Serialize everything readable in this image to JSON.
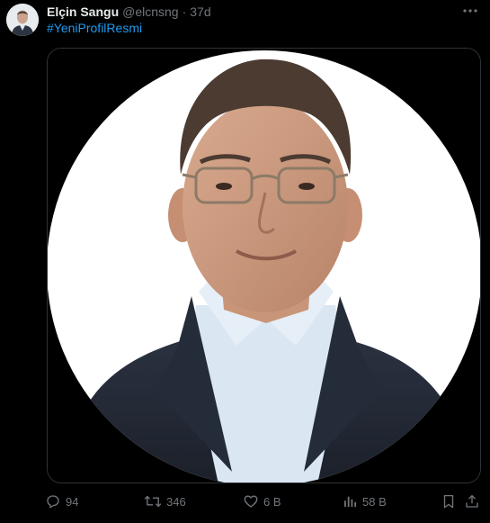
{
  "tweet": {
    "display_name": "Elçin Sangu",
    "handle": "@elcnsng",
    "separator": "·",
    "time": "37d",
    "text": "#YeniProfilResmi"
  },
  "actions": {
    "replies": "94",
    "retweets": "346",
    "likes": "6 B",
    "views": "58 B"
  },
  "icons": {
    "more": "more-horizontal-icon",
    "reply": "reply-icon",
    "retweet": "retweet-icon",
    "like": "heart-icon",
    "views": "views-chart-icon",
    "bookmark": "bookmark-icon",
    "share": "share-icon"
  },
  "colors": {
    "background": "#000000",
    "text_primary": "#e7e9ea",
    "text_secondary": "#71767b",
    "link": "#1d9bf0",
    "border": "#2f3336"
  }
}
